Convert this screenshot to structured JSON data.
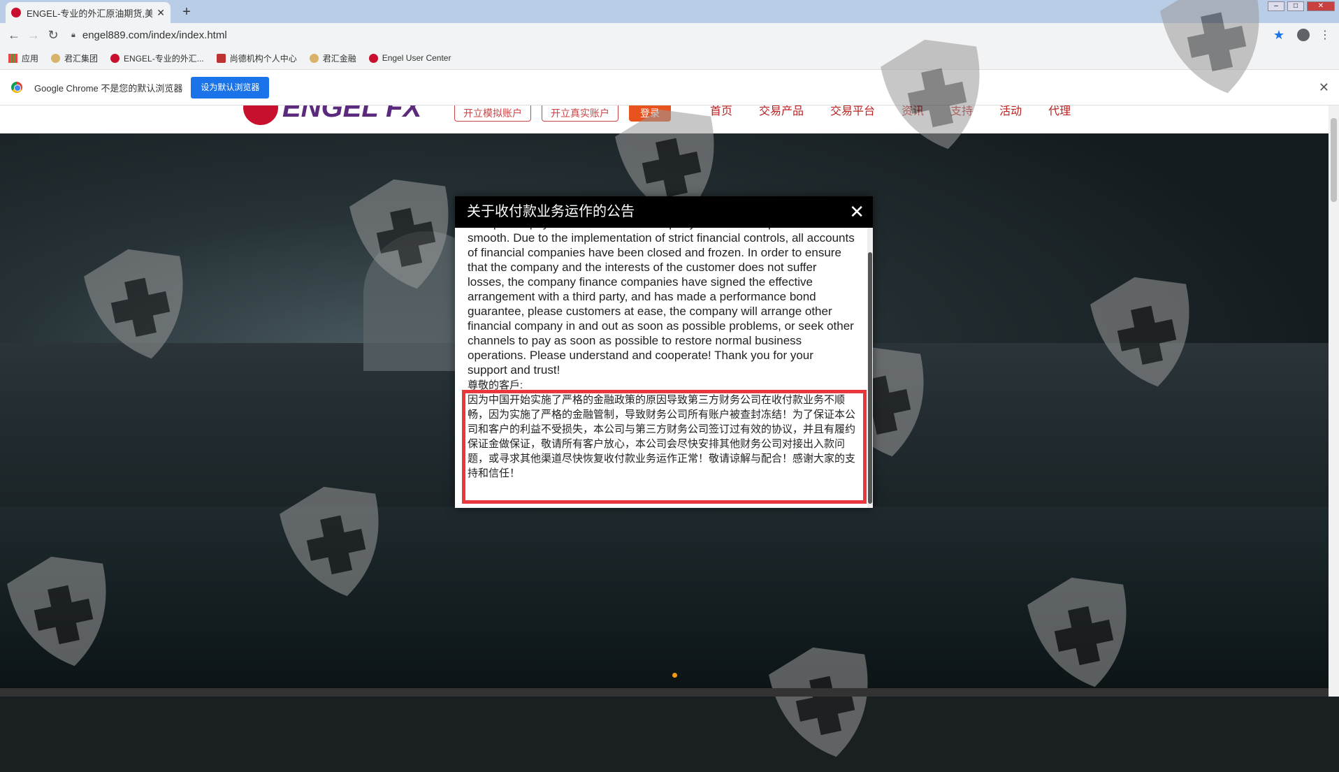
{
  "browser": {
    "tab_title": "ENGEL-专业的外汇原油期货,美",
    "url": "engel889.com/index/index.html",
    "bookmarks": [
      "应用",
      "君汇集团",
      "ENGEL-专业的外汇...",
      "尚德机构个人中心",
      "君汇金融",
      "Engel User Center"
    ],
    "infobar_text": "Google Chrome 不是您的默认浏览器",
    "infobar_button": "设为默认浏览器"
  },
  "site": {
    "logo_text": "ENGEL FX",
    "buttons": [
      "开立模拟账户",
      "开立真实账户",
      "登录"
    ],
    "nav": [
      "首页",
      "交易产品",
      "交易平台",
      "资讯",
      "支持",
      "活动",
      "代理"
    ]
  },
  "dialog": {
    "title": "关于收付款业务运作的公告",
    "close": "✕",
    "english_text": "receipt and payment business of third-party financial companies is not smooth. Due to the implementation of strict financial controls, all accounts of financial companies have been closed and frozen. In order to ensure that the company and the interests of the customer does not suffer losses, the company finance companies have signed the effective arrangement with a third party, and has made a performance bond guarantee, please customers at ease, the company will arrange other financial company in and out as soon as possible problems, or seek other channels to pay as soon as possible to restore normal business operations. Please understand and cooperate! Thank you for your support and trust!",
    "chinese_greeting": "尊敬的客戶:",
    "chinese_text": "因为中国开始实施了严格的金融政策的原因导致第三方财务公司在收付款业务不顺畅，因为实施了严格的金融管制，导致财务公司所有账户被查封冻结！为了保证本公司和客户的利益不受损失，本公司与第三方财务公司签订过有效的协议，并且有履约保证金做保证，敬请所有客户放心，本公司会尽快安排其他财务公司对接出入款问题，或寻求其他渠道尽快恢复收付款业务运作正常！敬请谅解与配合！感谢大家的支持和信任！"
  },
  "colors": {
    "accent": "#e8383d",
    "chrome_blue": "#1a73e8",
    "brand_red": "#c8102e"
  }
}
